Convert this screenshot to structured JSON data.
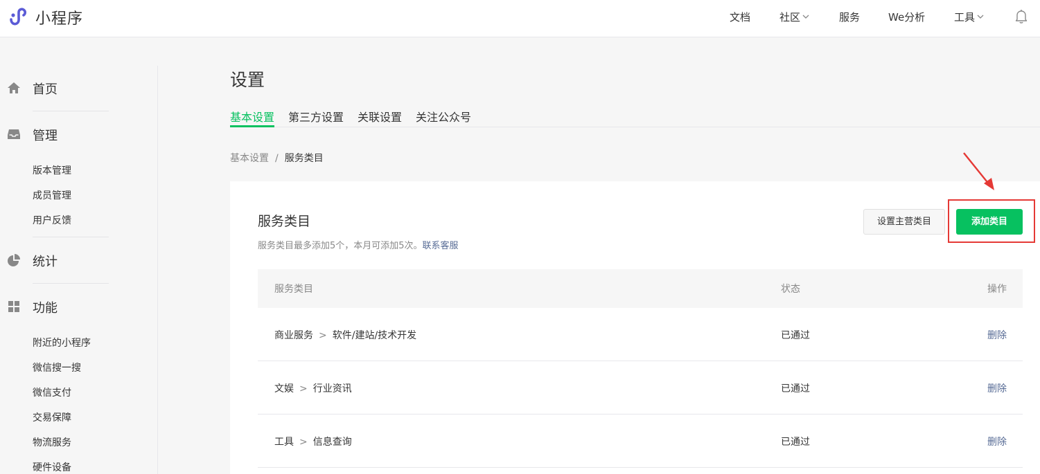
{
  "header": {
    "brand": "小程序",
    "brand_color": "#5b5bd6",
    "nav": [
      {
        "label": "文档",
        "has_dropdown": false
      },
      {
        "label": "社区",
        "has_dropdown": true
      },
      {
        "label": "服务",
        "has_dropdown": false
      },
      {
        "label": "We分析",
        "has_dropdown": false
      },
      {
        "label": "工具",
        "has_dropdown": true
      }
    ],
    "bell_icon": "bell-icon"
  },
  "sidebar": {
    "groups": [
      {
        "icon": "home-icon",
        "label": "首页",
        "items": []
      },
      {
        "icon": "inbox-icon",
        "label": "管理",
        "items": [
          "版本管理",
          "成员管理",
          "用户反馈"
        ]
      },
      {
        "icon": "pie-chart-icon",
        "label": "统计",
        "items": []
      },
      {
        "icon": "grid-icon",
        "label": "功能",
        "items": [
          "附近的小程序",
          "微信搜一搜",
          "微信支付",
          "交易保障",
          "物流服务",
          "硬件设备"
        ]
      }
    ]
  },
  "page": {
    "title": "设置",
    "tabs": [
      "基本设置",
      "第三方设置",
      "关联设置",
      "关注公众号"
    ],
    "active_tab": 0,
    "breadcrumb": {
      "parent": "基本设置",
      "separator": "/",
      "current": "服务类目"
    }
  },
  "card": {
    "title": "服务类目",
    "desc": "服务类目最多添加5个，本月可添加5次。",
    "desc_link": "联系客服",
    "btn_set_main": "设置主营类目",
    "btn_add": "添加类目"
  },
  "table": {
    "headers": [
      "服务类目",
      "状态",
      "操作"
    ],
    "rows": [
      {
        "cat1": "商业服务",
        "sep": ">",
        "cat2": "软件/建站/技术开发",
        "status": "已通过",
        "op": "删除"
      },
      {
        "cat1": "文娱",
        "sep": ">",
        "cat2": "行业资讯",
        "status": "已通过",
        "op": "删除"
      },
      {
        "cat1": "工具",
        "sep": ">",
        "cat2": "信息查询",
        "status": "已通过",
        "op": "删除"
      }
    ]
  },
  "colors": {
    "primary_green": "#07c160",
    "link_blue": "#576b95",
    "annotation_red": "#e53935"
  }
}
